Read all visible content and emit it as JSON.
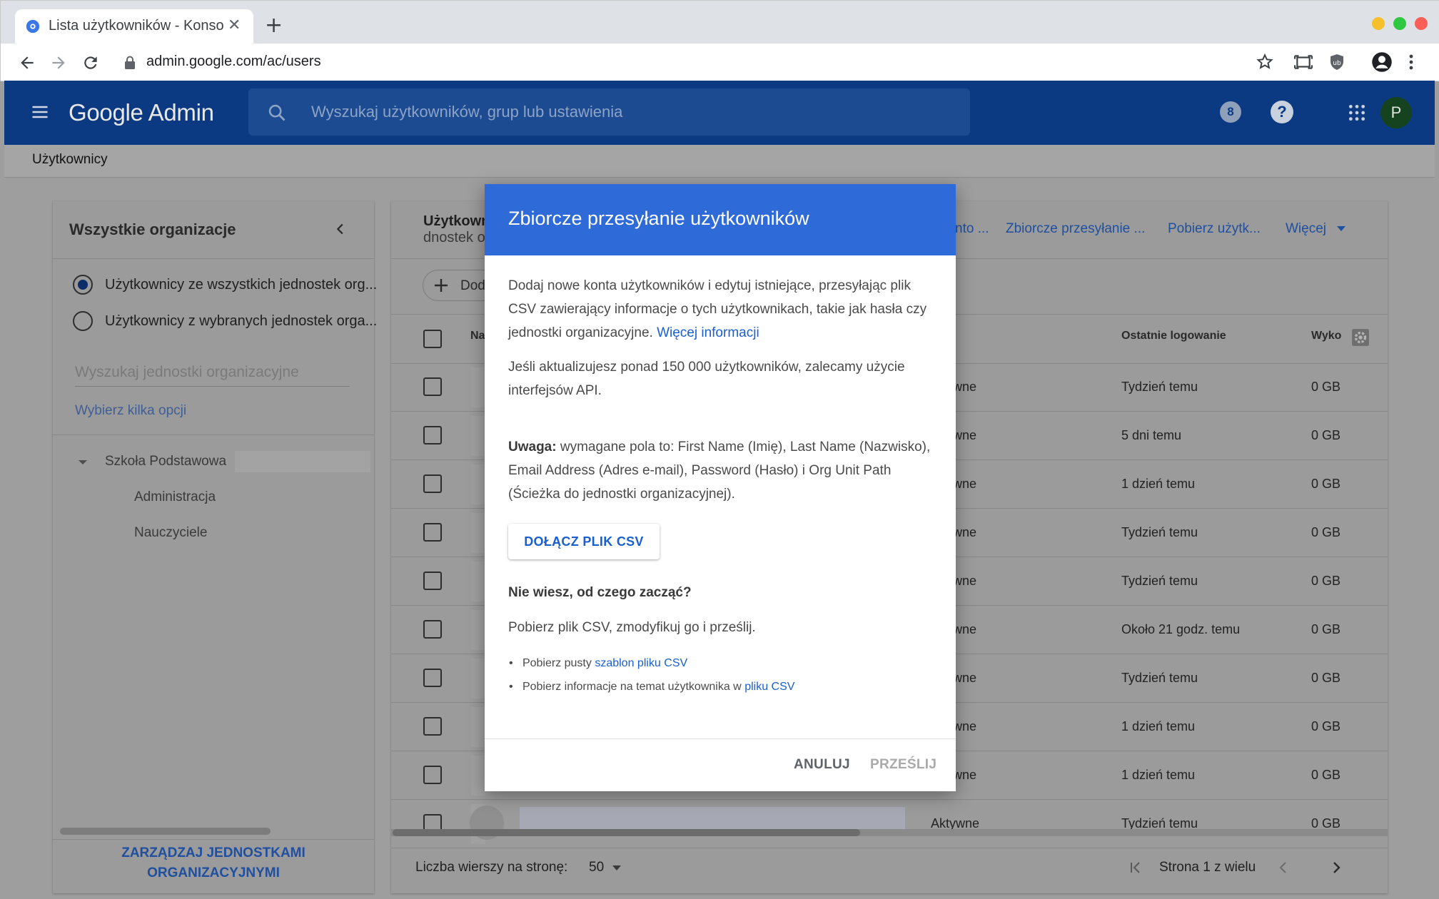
{
  "browser": {
    "tab_title": "Lista użytkowników - Konsola administracyjna",
    "tab_close": "✕",
    "new_tab": "+",
    "url": "admin.google.com/ac/users",
    "traffic_colors": [
      "#f5c02c",
      "#2ec840",
      "#f95f57"
    ]
  },
  "header": {
    "brand": "Google Admin",
    "search_placeholder": "Wyszukaj użytkowników, grup lub ustawienia",
    "badge_count": "8",
    "help": "?",
    "avatar_letter": "P",
    "color": "#0b3a82"
  },
  "breadcrumb": "Użytkownicy",
  "left_panel": {
    "title": "Wszystkie organizacje",
    "radio_all": "Użytkownicy ze wszystkich jednostek org...",
    "radio_selected": "Użytkownicy z wybranych jednostek orga...",
    "search_placeholder": "Wyszukaj jednostki organizacyjne",
    "choose_link": "Wybierz kilka opcji",
    "tree": {
      "root": "Szkoła Podstawowa",
      "children": [
        "Administracja",
        "Nauczyciele"
      ]
    },
    "manage_button_line1": "ZARZĄDZAJ JEDNOSTKAMI",
    "manage_button_line2": "ORGANIZACYJNYMI"
  },
  "right_panel": {
    "title_line1": "Użytkownicy",
    "title_line2": "dnostek o",
    "actions": [
      "nto ...",
      "Zbiorcze przesyłanie ...",
      "Pobierz użytk...",
      "Więcej"
    ],
    "add_button": "Dod",
    "columns": {
      "name": "Na",
      "last_login": "Ostatnie logowanie",
      "usage": "Wyko"
    },
    "rows": [
      {
        "status": "wne",
        "last_login": "Tydzień temu",
        "usage": "0 GB"
      },
      {
        "status": "wne",
        "last_login": "5 dni temu",
        "usage": "0 GB"
      },
      {
        "status": "wne",
        "last_login": "1 dzień temu",
        "usage": "0 GB"
      },
      {
        "status": "wne",
        "last_login": "Tydzień temu",
        "usage": "0 GB"
      },
      {
        "status": "wne",
        "last_login": "Tydzień temu",
        "usage": "0 GB"
      },
      {
        "status": "wne",
        "last_login": "Około 21 godz. temu",
        "usage": "0 GB"
      },
      {
        "status": "wne",
        "last_login": "Tydzień temu",
        "usage": "0 GB"
      },
      {
        "status": "wne",
        "last_login": "1 dzień temu",
        "usage": "0 GB"
      },
      {
        "status": "wne",
        "last_login": "1 dzień temu",
        "usage": "0 GB"
      },
      {
        "status": "Aktywne",
        "last_login": "Tydzień temu",
        "usage": "0 GB"
      }
    ],
    "rows_per_page_label": "Liczba wierszy na stronę:",
    "rows_per_page_value": "50",
    "page_label": "Strona 1 z wielu"
  },
  "modal": {
    "title": "Zbiorcze przesyłanie użytkowników",
    "intro": "Dodaj nowe konta użytkowników i edytuj istniejące, przesyłając plik CSV zawierający informacje o tych użytkownikach, takie jak hasła czy jednostki organizacyjne.",
    "intro_link": "Więcej informacji",
    "api_note": "Jeśli aktualizujesz ponad 150 000 użytkowników, zalecamy użycie interfejsów API.",
    "warning_label": "Uwaga:",
    "warning_text": "wymagane pola to: First Name (Imię), Last Name (Nazwisko), Email Address (Adres e-mail), Password (Hasło) i Org Unit Path (Ścieżka do jednostki organizacyjnej).",
    "attach_button": "DOŁĄCZ PLIK CSV",
    "help_heading": "Nie wiesz, od czego zacząć?",
    "help_text": "Pobierz plik CSV, zmodyfikuj go i prześlij.",
    "bullet1_text": "Pobierz pusty",
    "bullet1_link": "szablon pliku CSV",
    "bullet2_text": "Pobierz informacje na temat użytkownika w",
    "bullet2_link": "pliku CSV",
    "cancel": "ANULUJ",
    "submit": "PRZEŚLIJ",
    "header_color": "#2f6ad9",
    "link_color": "#1a5fd0"
  }
}
